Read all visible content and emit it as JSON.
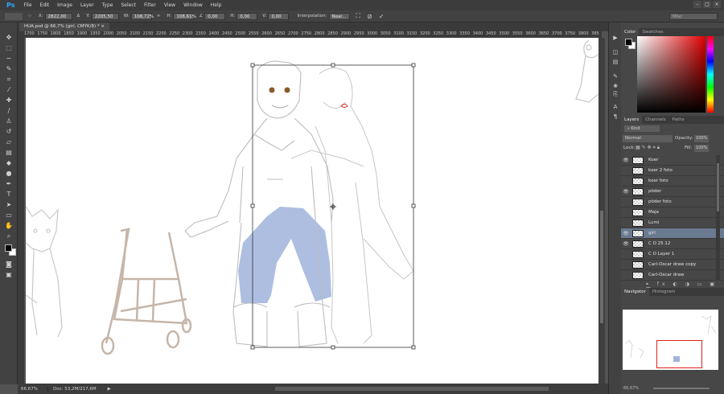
{
  "app": {
    "logo": "Ps"
  },
  "menu": [
    "File",
    "Edit",
    "Image",
    "Layer",
    "Type",
    "Select",
    "Filter",
    "View",
    "Window",
    "Help"
  ],
  "window_controls": [
    "–",
    "□",
    "×"
  ],
  "options": {
    "x_label": "X:",
    "x_value": "2822,00 p",
    "y_label": "Y:",
    "y_value": "2205,50 p",
    "w_label": "W:",
    "w_value": "108,72%",
    "link_label": "∞",
    "h_label": "H:",
    "h_value": "108,61%",
    "angle_label": "∠",
    "angle_value": "0,00",
    "hskew_label": "H:",
    "hskew_value": "0,00",
    "vskew_label": "V:",
    "vskew_value": "0,00",
    "interp_label": "Interpolation:",
    "interp_value": "Near...",
    "cancel_glyph": "⊘",
    "commit_glyph": "✓",
    "workspace": "Misc"
  },
  "document_tab": "HUA.psd @ 66,7% (girl, CMYK/8) * ×",
  "ruler_ticks": [
    "1700",
    "1750",
    "1800",
    "1850",
    "1900",
    "1950",
    "2000",
    "2050",
    "2100",
    "2150",
    "2200",
    "2250",
    "2300",
    "2350",
    "2400",
    "2450",
    "2500",
    "2550",
    "2600",
    "2650",
    "2700",
    "2750",
    "2800",
    "2850",
    "2900",
    "2950",
    "3000",
    "3050",
    "3100",
    "3150",
    "3200",
    "3250",
    "3300",
    "3350",
    "3400",
    "3450",
    "3500",
    "3550",
    "3600",
    "3650",
    "3700",
    "3750",
    "3800",
    "385"
  ],
  "status": {
    "zoom": "66,67%",
    "doc": "Doc: 53,2M/217,6M",
    "arrow": "▶"
  },
  "color_panel": {
    "tabs": [
      "Color",
      "Swatches"
    ],
    "fg": "#000000",
    "bg": "#ffffff"
  },
  "layers_panel": {
    "tabs": [
      "Layers",
      "Channels",
      "Paths"
    ],
    "filter": "Kind",
    "blend_mode": "Normal",
    "opacity_label": "Opacity:",
    "opacity_value": "100%",
    "lock_label": "Lock:",
    "fill_label": "Fill:",
    "fill_value": "100%",
    "layers": [
      {
        "name": "Koer",
        "visible": true,
        "selected": false
      },
      {
        "name": "koer 2 foto",
        "visible": false,
        "selected": false
      },
      {
        "name": "koer foto",
        "visible": false,
        "selected": false
      },
      {
        "name": "põder",
        "visible": true,
        "selected": false
      },
      {
        "name": "põder foto",
        "visible": false,
        "selected": false
      },
      {
        "name": "Maja",
        "visible": false,
        "selected": false
      },
      {
        "name": "Lumi",
        "visible": false,
        "selected": false
      },
      {
        "name": "girl",
        "visible": true,
        "selected": true
      },
      {
        "name": "C O 25.12",
        "visible": true,
        "selected": false
      },
      {
        "name": "C O Layer 1",
        "visible": false,
        "selected": false
      },
      {
        "name": "Carl-Oscar draw copy",
        "visible": false,
        "selected": false
      },
      {
        "name": "Carl-Oscar draw",
        "visible": false,
        "selected": false
      }
    ],
    "footer_icons": [
      "link-icon",
      "fx-icon",
      "mask-icon",
      "adjustment-icon",
      "group-icon",
      "new-layer-icon",
      "trash-icon"
    ]
  },
  "navigator_panel": {
    "tabs": [
      "Navigator",
      "Histogram"
    ],
    "zoom": "66,67%"
  },
  "colors": {
    "selection_bg": "#6a7a91",
    "jeans_fill": "#9fb3dc",
    "eye_brown": "#8a5a2b",
    "lips_red": "#d03030"
  }
}
